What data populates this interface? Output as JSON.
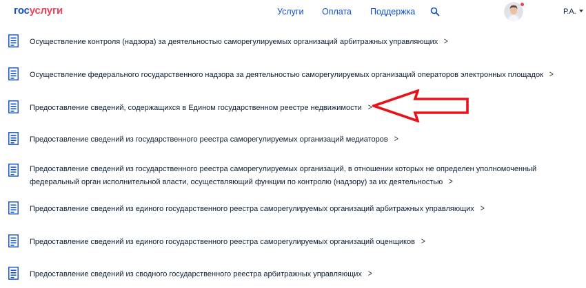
{
  "header": {
    "logo_part1": "гос",
    "logo_part2": "услуги",
    "nav": [
      "Услуги",
      "Оплата",
      "Поддержка"
    ],
    "user_name": "Р.А."
  },
  "services": [
    "Осуществление контроля (надзора) за деятельностью саморегулируемых организаций арбитражных управляющих",
    "Осуществление федерального государственного надзора за деятельностью саморегулируемых организаций операторов электронных площадок",
    "Предоставление сведений, содержащихся в Едином государственном реестре недвижимости",
    "Предоставление сведений из государственного реестра саморегулируемых организаций медиаторов",
    "Предоставление сведений из государственного реестра саморегулируемых организаций, в отношении которых не определен уполномоченный федеральный орган исполнительной власти, осуществляющий функции по контролю (надзору) за их деятельностью",
    "Предоставление сведений из единого государственного реестра саморегулируемых организаций арбитражных управляющих",
    "Предоставление сведений из единого государственного реестра саморегулируемых организаций оценщиков",
    "Предоставление сведений из сводного государственного реестра арбитражных управляющих"
  ],
  "icons": {
    "search": "search-icon",
    "document": "document-icon",
    "chevron": "chevron-right-icon",
    "caret": "caret-down-icon",
    "annotation": "red-arrow-annotation"
  },
  "colors": {
    "brand_blue": "#0d4cd3",
    "brand_red": "#ee3f58",
    "text": "#0b1f33",
    "annotation_red": "#e8121a"
  }
}
